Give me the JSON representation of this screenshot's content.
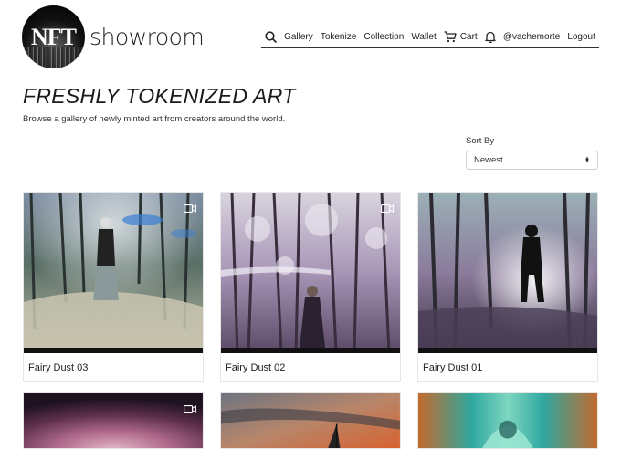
{
  "logo": {
    "badge": "NFT",
    "text": "showroom"
  },
  "nav": {
    "items": [
      "Gallery",
      "Tokenize",
      "Collection",
      "Wallet"
    ],
    "cart": "Cart",
    "user": "@vachemorte",
    "logout": "Logout"
  },
  "heading": "FRESHLY TOKENIZED ART",
  "subheading": "Browse a gallery of newly minted art from creators around the world.",
  "sort": {
    "label": "Sort By",
    "value": "Newest"
  },
  "cards": [
    {
      "title": "Fairy Dust 03",
      "has_video": true
    },
    {
      "title": "Fairy Dust 02",
      "has_video": true
    },
    {
      "title": "Fairy Dust 01",
      "has_video": false
    }
  ],
  "partial_cards": [
    {
      "has_video": true
    },
    {
      "has_video": false
    },
    {
      "has_video": false
    }
  ]
}
